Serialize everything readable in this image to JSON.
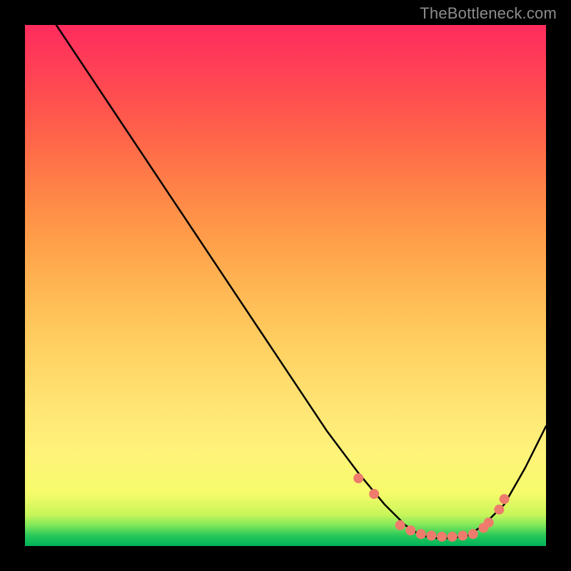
{
  "watermark": "TheBottleneck.com",
  "chart_data": {
    "type": "line",
    "title": "",
    "xlabel": "",
    "ylabel": "",
    "xlim": [
      0,
      100
    ],
    "ylim": [
      0,
      100
    ],
    "series": [
      {
        "name": "bottleneck-curve",
        "x": [
          6,
          10,
          16,
          22,
          28,
          34,
          40,
          46,
          52,
          58,
          64,
          69,
          73,
          76,
          79,
          82,
          85,
          88,
          92,
          96,
          100
        ],
        "y": [
          100,
          94,
          85,
          76,
          67,
          58,
          49,
          40,
          31,
          22,
          14,
          8,
          4,
          2,
          1.5,
          1.5,
          2,
          4,
          8,
          15,
          23
        ]
      }
    ],
    "markers": {
      "name": "highlight-dots",
      "color": "#ef7b6c",
      "radius_px": 7,
      "x": [
        64,
        67,
        72,
        74,
        76,
        78,
        80,
        82,
        84,
        86,
        88,
        89,
        91,
        92
      ],
      "y": [
        13,
        10,
        4,
        3,
        2.3,
        2,
        1.8,
        1.8,
        2,
        2.3,
        3.5,
        4.5,
        7,
        9
      ]
    },
    "background_gradient": {
      "stops": [
        {
          "pos": 0.0,
          "color": "#00b35a"
        },
        {
          "pos": 0.06,
          "color": "#c8f55a"
        },
        {
          "pos": 0.18,
          "color": "#fff37a"
        },
        {
          "pos": 0.5,
          "color": "#ffb552"
        },
        {
          "pos": 0.82,
          "color": "#ff5a4c"
        },
        {
          "pos": 1.0,
          "color": "#ff2c5e"
        }
      ]
    }
  }
}
